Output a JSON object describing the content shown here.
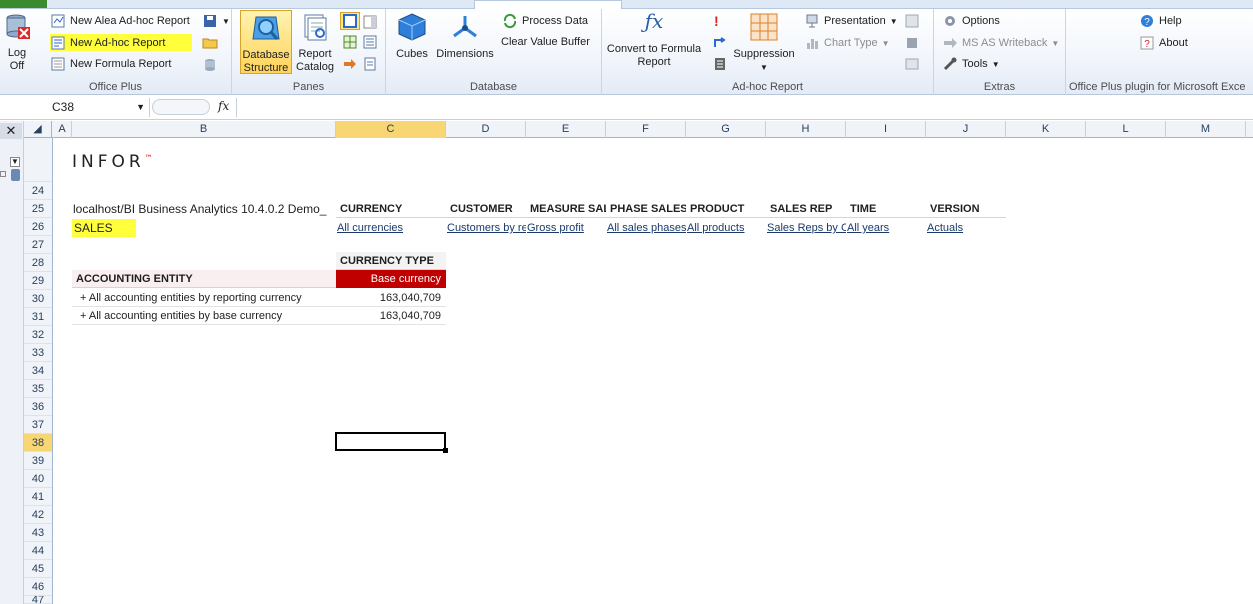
{
  "ribbon": {
    "office_plus": {
      "log_off": "Log Off",
      "new_alea_adhoc": "New Alea Ad-hoc Report",
      "new_adhoc": "New Ad-hoc Report",
      "new_formula": "New Formula Report",
      "label": "Office Plus"
    },
    "panes": {
      "database_structure": "Database Structure",
      "report_catalog": "Report Catalog",
      "label": "Panes"
    },
    "database": {
      "cubes": "Cubes",
      "dimensions": "Dimensions",
      "process_data": "Process Data",
      "clear_value_buffer": "Clear Value Buffer",
      "label": "Database"
    },
    "adhoc": {
      "convert": "Convert to Formula Report",
      "suppression": "Suppression",
      "presentation": "Presentation",
      "chart_type": "Chart Type",
      "label": "Ad-hoc Report"
    },
    "extras": {
      "options": "Options",
      "writeback": "MS AS Writeback",
      "tools": "Tools",
      "label": "Extras"
    },
    "help": {
      "help": "Help",
      "about": "About",
      "label": "Office Plus plugin for Microsoft Exce"
    }
  },
  "formula_bar": {
    "name_box": "C38",
    "fx": "fx",
    "formula": ""
  },
  "columns": [
    "A",
    "B",
    "C",
    "D",
    "E",
    "F",
    "G",
    "H",
    "I",
    "J",
    "K",
    "L",
    "M"
  ],
  "rows": [
    "24",
    "25",
    "26",
    "27",
    "28",
    "29",
    "30",
    "31",
    "32",
    "33",
    "34",
    "35",
    "36",
    "37",
    "38",
    "39",
    "40",
    "41",
    "42",
    "43",
    "44",
    "45",
    "46",
    "47"
  ],
  "sheet": {
    "logo": "INFOR",
    "connection": "localhost/BI Business Analytics 10.4.0.2 Demo_",
    "cube": "SALES",
    "dimensions": [
      {
        "name": "CURRENCY",
        "value": "All currencies"
      },
      {
        "name": "CUSTOMER",
        "value": "Customers by re"
      },
      {
        "name": "MEASURE SAL",
        "value": "Gross profit"
      },
      {
        "name": "PHASE SALES",
        "value": "All sales phases"
      },
      {
        "name": "PRODUCT",
        "value": "All products"
      },
      {
        "name": "SALES REP",
        "value": "Sales Reps by C"
      },
      {
        "name": "TIME",
        "value": "All years"
      },
      {
        "name": "VERSION",
        "value": "Actuals"
      }
    ],
    "currency_type_header": "CURRENCY TYPE",
    "base_currency": "Base currency",
    "row_dim": "ACCOUNTING ENTITY",
    "data_rows": [
      {
        "label": "+ All accounting entities by reporting currency",
        "value": "163,040,709"
      },
      {
        "label": "+ All accounting entities by base currency",
        "value": "163,040,709"
      }
    ]
  },
  "colors": {
    "accent_red": "#c00000",
    "highlight": "#ffff3c"
  }
}
